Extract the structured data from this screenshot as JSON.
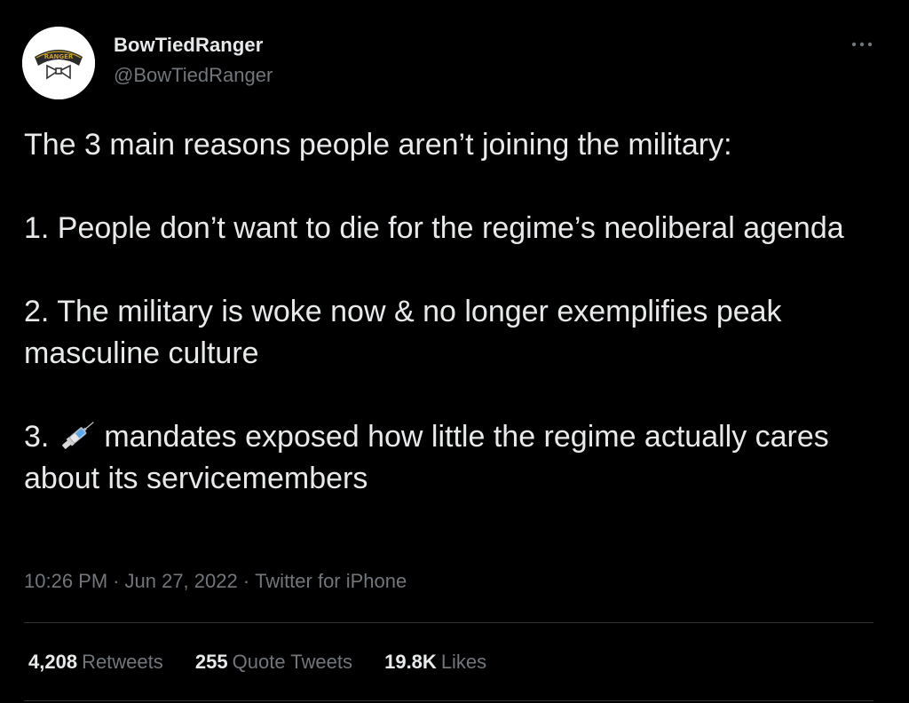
{
  "author": {
    "display_name": "BowTiedRanger",
    "handle": "@BowTiedRanger",
    "avatar_icon": "ranger-tab-bowtie-avatar",
    "avatar_tab_text": "RANGER"
  },
  "tweet": {
    "intro": "The 3 main reasons people aren’t joining the military:",
    "point1": "1. People don’t want to die for the regime’s neoliberal agenda",
    "point2": "2. The military is woke now & no longer exemplifies peak masculine culture",
    "point3_prefix": "3.",
    "point3_emoji_icon": "syringe-icon",
    "point3_rest": "mandates exposed how little the regime actually cares about its servicemembers"
  },
  "meta": {
    "time": "10:26 PM",
    "separator": "·",
    "date": "Jun 27, 2022",
    "source": "Twitter for iPhone"
  },
  "stats": {
    "retweets_count": "4,208",
    "retweets_label": "Retweets",
    "quotes_count": "255",
    "quotes_label": "Quote Tweets",
    "likes_count": "19.8K",
    "likes_label": "Likes"
  },
  "colors": {
    "background": "#000000",
    "primary_text": "#e7e9ea",
    "secondary_text": "#71767b",
    "divider": "#2f3336"
  }
}
